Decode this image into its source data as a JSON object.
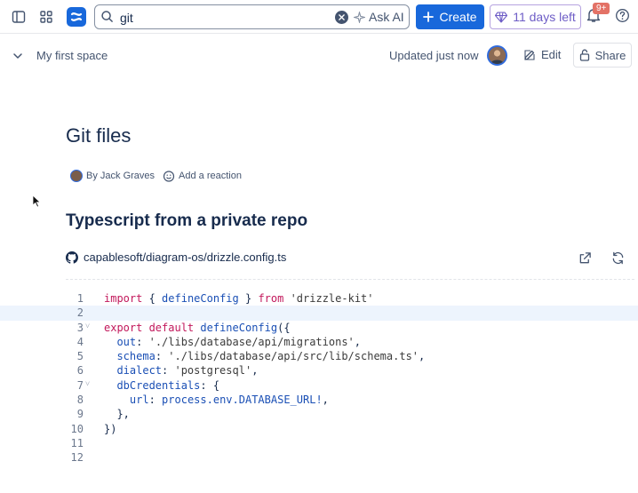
{
  "topbar": {
    "search_value": "git",
    "ask_ai_label": "Ask AI",
    "create_label": "Create",
    "trial_label": "11 days left",
    "notifications_badge": "9+",
    "brand_color": "#1868db"
  },
  "page_header": {
    "space_name": "My first space",
    "updated_text": "Updated just now",
    "edit_label": "Edit",
    "share_label": "Share"
  },
  "page": {
    "title": "Git files",
    "author": "By Jack Graves",
    "reaction_label": "Add a reaction",
    "section_heading": "Typescript from a private repo",
    "repo_path": "capablesoft/diagram-os/drizzle.config.ts"
  },
  "code": {
    "lines": [
      {
        "n": "1",
        "fold": "",
        "tokens": [
          [
            "kw",
            "import"
          ],
          [
            "t",
            " { "
          ],
          [
            "fn",
            "defineConfig"
          ],
          [
            "t",
            " } "
          ],
          [
            "kw",
            "from"
          ],
          [
            "t",
            " "
          ],
          [
            "str",
            "'drizzle-kit'"
          ]
        ]
      },
      {
        "n": "2",
        "fold": "",
        "tokens": []
      },
      {
        "n": "3",
        "fold": "v",
        "tokens": [
          [
            "kw",
            "export default"
          ],
          [
            "t",
            " "
          ],
          [
            "fn",
            "defineConfig"
          ],
          [
            "t",
            "({"
          ]
        ]
      },
      {
        "n": "4",
        "fold": "",
        "tokens": [
          [
            "t",
            "  "
          ],
          [
            "prop",
            "out"
          ],
          [
            "t",
            ": "
          ],
          [
            "str",
            "'./libs/database/api/migrations'"
          ],
          [
            "t",
            ","
          ]
        ]
      },
      {
        "n": "5",
        "fold": "",
        "tokens": [
          [
            "t",
            "  "
          ],
          [
            "prop",
            "schema"
          ],
          [
            "t",
            ": "
          ],
          [
            "str",
            "'./libs/database/api/src/lib/schema.ts'"
          ],
          [
            "t",
            ","
          ]
        ]
      },
      {
        "n": "6",
        "fold": "",
        "tokens": [
          [
            "t",
            "  "
          ],
          [
            "prop",
            "dialect"
          ],
          [
            "t",
            ": "
          ],
          [
            "str",
            "'postgresql'"
          ],
          [
            "t",
            ","
          ]
        ]
      },
      {
        "n": "7",
        "fold": "v",
        "tokens": [
          [
            "t",
            "  "
          ],
          [
            "prop",
            "dbCredentials"
          ],
          [
            "t",
            ": {"
          ]
        ]
      },
      {
        "n": "8",
        "fold": "",
        "tokens": [
          [
            "t",
            "    "
          ],
          [
            "prop",
            "url"
          ],
          [
            "t",
            ": "
          ],
          [
            "fn",
            "process.env.DATABASE_URL!"
          ],
          [
            "t",
            ","
          ]
        ]
      },
      {
        "n": "9",
        "fold": "",
        "tokens": [
          [
            "t",
            "  },"
          ]
        ]
      },
      {
        "n": "10",
        "fold": "",
        "tokens": [
          [
            "t",
            "})"
          ]
        ]
      },
      {
        "n": "11",
        "fold": "",
        "tokens": []
      },
      {
        "n": "12",
        "fold": "",
        "tokens": []
      }
    ],
    "highlighted_line": "2"
  }
}
